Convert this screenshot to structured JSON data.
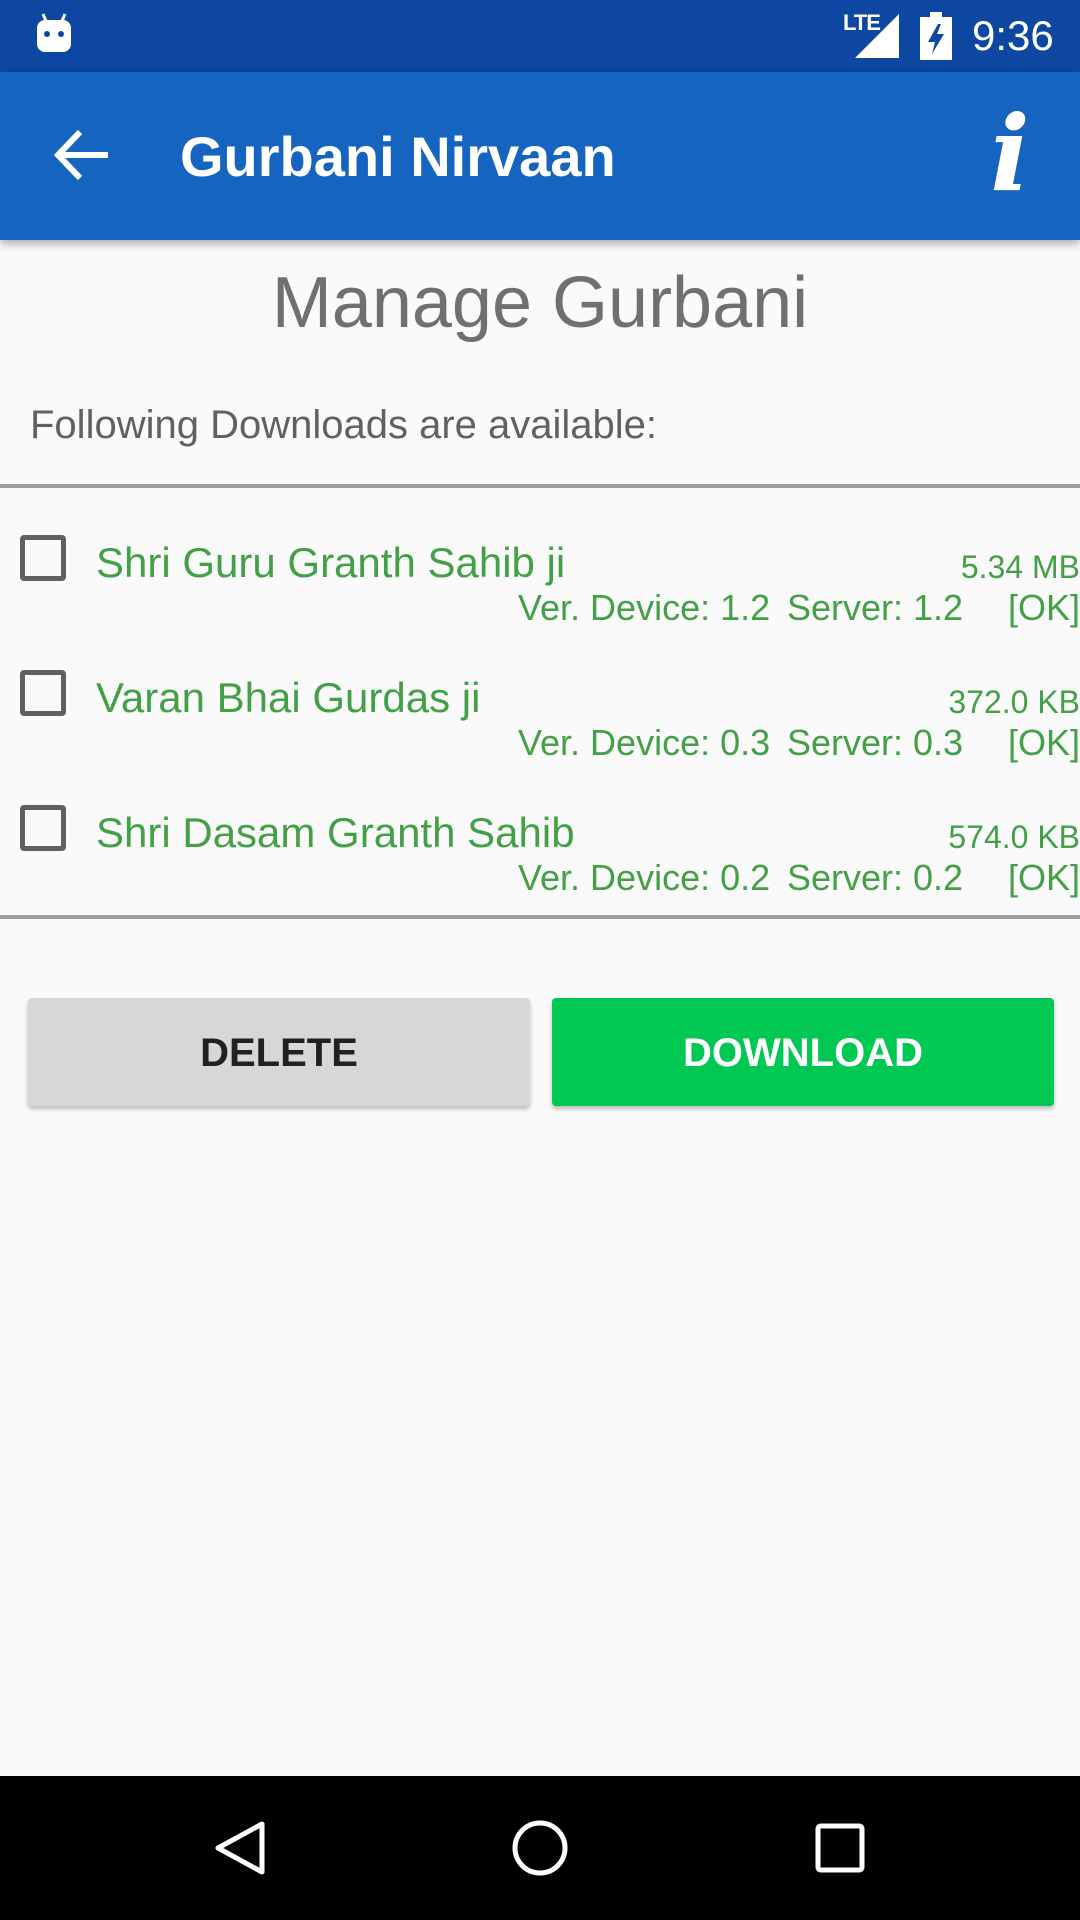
{
  "status_bar": {
    "network": "LTE",
    "time": "9:36",
    "icons": [
      "android-notification-icon",
      "signal-icon",
      "battery-charging-icon"
    ]
  },
  "app_bar": {
    "title": "Gurbani Nirvaan",
    "back_icon": "arrow-back-icon",
    "info_label": "i"
  },
  "main": {
    "heading": "Manage Gurbani",
    "subheading": "Following Downloads are available:",
    "items": [
      {
        "title": "Shri Guru Granth Sahib ji",
        "size": "5.34 MB",
        "device_version": "Ver. Device: 1.2",
        "server_version": "Server: 1.2",
        "status": "[OK]",
        "checked": false
      },
      {
        "title": "Varan Bhai Gurdas ji",
        "size": "372.0 KB",
        "device_version": "Ver. Device: 0.3",
        "server_version": "Server: 0.3",
        "status": "[OK]",
        "checked": false
      },
      {
        "title": "Shri Dasam Granth Sahib",
        "size": "574.0 KB",
        "device_version": "Ver. Device: 0.2",
        "server_version": "Server: 0.2",
        "status": "[OK]",
        "checked": false
      }
    ],
    "delete_label": "DELETE",
    "download_label": "DOWNLOAD"
  },
  "colors": {
    "status_bar": "#0d47a1",
    "app_bar": "#1565c0",
    "item_text": "#43a047",
    "download_button": "#00c853",
    "delete_button": "#d6d7d7"
  },
  "nav_bar": {
    "icons": [
      "back-triangle-icon",
      "home-circle-icon",
      "recents-square-icon"
    ]
  }
}
